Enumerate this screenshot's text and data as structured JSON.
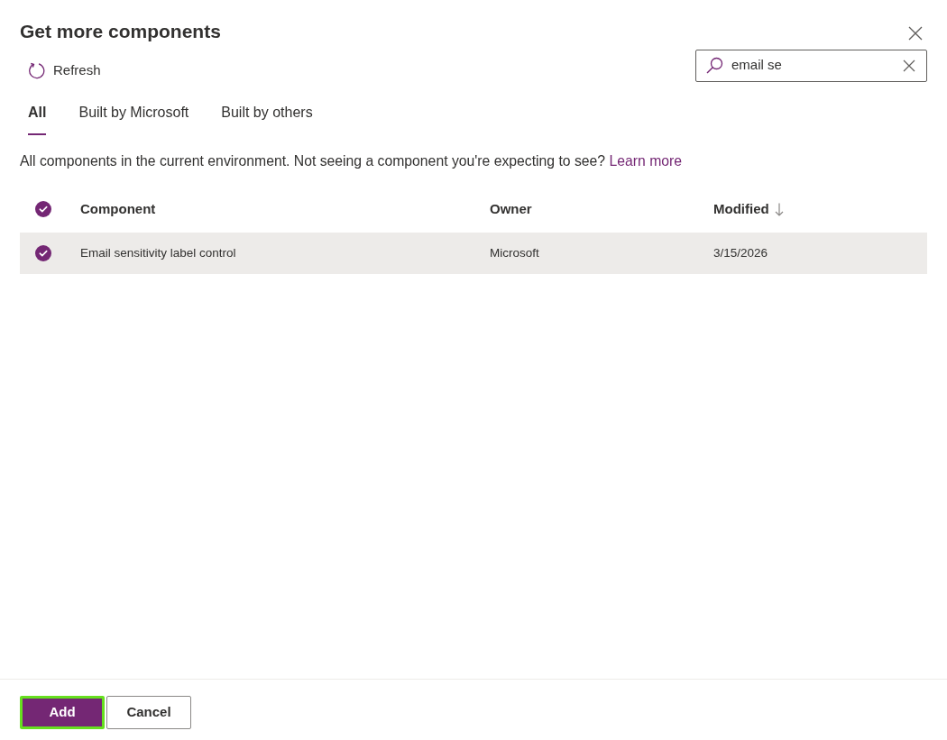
{
  "dialog": {
    "title": "Get more components"
  },
  "toolbar": {
    "refresh": "Refresh"
  },
  "search": {
    "value": "email se"
  },
  "tabs": [
    {
      "label": "All",
      "selected": true
    },
    {
      "label": "Built by Microsoft",
      "selected": false
    },
    {
      "label": "Built by others",
      "selected": false
    }
  ],
  "description": {
    "text": "All components in the current environment. Not seeing a component you're expecting to see?",
    "link": "Learn more"
  },
  "table": {
    "select_all_checked": true,
    "columns": [
      {
        "label": "Component",
        "sorted": false
      },
      {
        "label": "Owner",
        "sorted": false
      },
      {
        "label": "Modified",
        "sorted": true
      }
    ],
    "rows": [
      {
        "selected": true,
        "cells": [
          "Email sensitivity label control",
          "Microsoft",
          "3/15/2026"
        ]
      }
    ]
  },
  "footer": {
    "buttons": [
      {
        "label": "Add",
        "kind": "primary",
        "highlighted": true
      },
      {
        "label": "Cancel",
        "kind": "secondary",
        "highlighted": false
      }
    ]
  }
}
